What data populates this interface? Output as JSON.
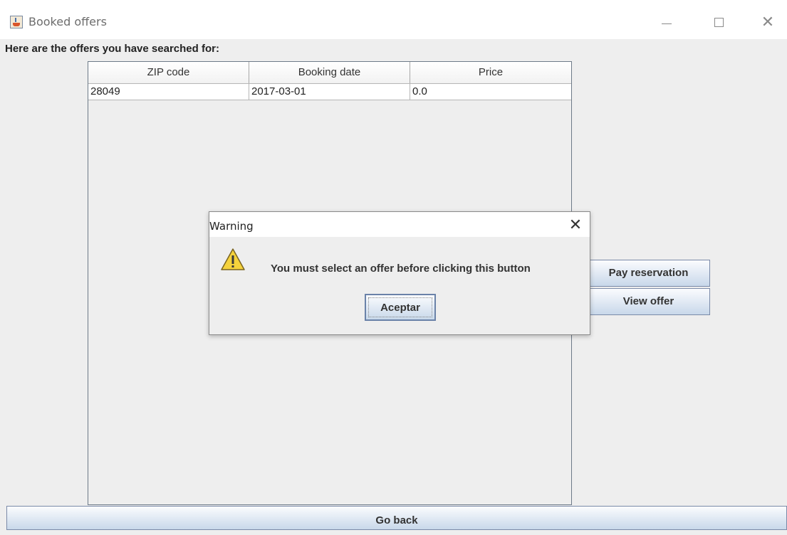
{
  "window": {
    "title": "Booked offers",
    "close_glyph": "✕"
  },
  "heading": "Here are the offers you have searched for:",
  "table": {
    "columns": [
      "ZIP code",
      "Booking date",
      "Price"
    ],
    "rows": [
      [
        "28049",
        "2017-03-01",
        "0.0"
      ]
    ]
  },
  "buttons": {
    "pay": "Pay reservation",
    "view": "View offer",
    "go_back": "Go back"
  },
  "dialog": {
    "title": "Warning",
    "close_glyph": "✕",
    "message": "You must select an offer before clicking this button",
    "ok": "Aceptar",
    "icon": "warning-icon"
  }
}
